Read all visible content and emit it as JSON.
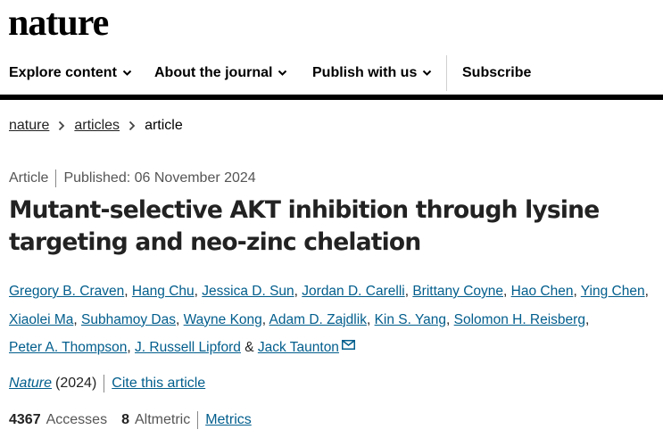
{
  "site": {
    "logo": "nature"
  },
  "nav": {
    "items": [
      {
        "label": "Explore content",
        "has_dropdown": true
      },
      {
        "label": "About the journal",
        "has_dropdown": true
      },
      {
        "label": "Publish with us",
        "has_dropdown": true
      }
    ],
    "subscribe": "Subscribe"
  },
  "breadcrumb": {
    "items": [
      "nature",
      "articles"
    ],
    "current": "article"
  },
  "article": {
    "type": "Article",
    "published": "Published: 06 November 2024",
    "title": "Mutant-selective AKT inhibition through lysine targeting and neo-zinc chelation",
    "authors": [
      "Gregory B. Craven",
      "Hang Chu",
      "Jessica D. Sun",
      "Jordan D. Carelli",
      "Brittany Coyne",
      "Hao Chen",
      "Ying Chen",
      "Xiaolei Ma",
      "Subhamoy Das",
      "Wayne Kong",
      "Adam D. Zajdlik",
      "Kin S. Yang",
      "Solomon H. Reisberg",
      "Peter A. Thompson",
      "J. Russell Lipford",
      "Jack Taunton"
    ],
    "author_separator": ", ",
    "author_last_separator": " & ",
    "journal": "Nature",
    "year": "(2024)",
    "cite_label": "Cite this article"
  },
  "metrics": {
    "accesses_value": "4367",
    "accesses_label": "Accesses",
    "altmetric_value": "8",
    "altmetric_label": "Altmetric",
    "metrics_link": "Metrics"
  },
  "colors": {
    "link": "#025e8d",
    "text": "#222222",
    "rule": "#000000"
  },
  "icons": {
    "dropdown": "chevron-down-icon",
    "breadcrumb_separator": "chevron-right-icon",
    "corresponding_author": "envelope-icon"
  }
}
